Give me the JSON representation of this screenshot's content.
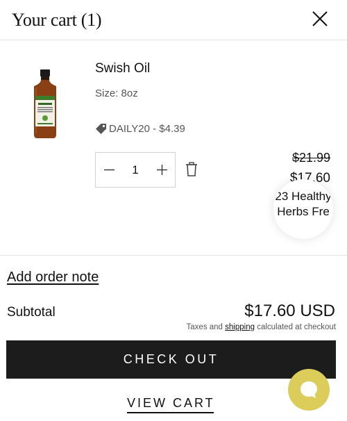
{
  "cart": {
    "title": "Your cart (1)",
    "close_icon": "close-icon"
  },
  "item": {
    "name": "Swish Oil",
    "size": "Size: 8oz",
    "discount": "DAILY20 - $4.39",
    "discount_icon": "tag-icon",
    "quantity": "1",
    "price_original": "$21.99",
    "price_final": "$17.60",
    "image_icon": "amber-bottle-image"
  },
  "promo_badge": {
    "text": "23 Healthy Herbs Fre"
  },
  "order_note": {
    "label": "Add order note"
  },
  "summary": {
    "subtotal_label": "Subtotal",
    "subtotal_value": "$17.60 USD",
    "taxes_prefix": "Taxes and ",
    "taxes_link": "shipping",
    "taxes_suffix": " calculated at checkout"
  },
  "actions": {
    "checkout_label": "CHECK OUT",
    "view_cart_label": "VIEW CART"
  },
  "chat": {
    "icon": "chat-icon"
  },
  "colors": {
    "checkout_bg": "#1c1c1c",
    "chat_bg": "#dccd5a",
    "divider": "#e2e2e2"
  }
}
